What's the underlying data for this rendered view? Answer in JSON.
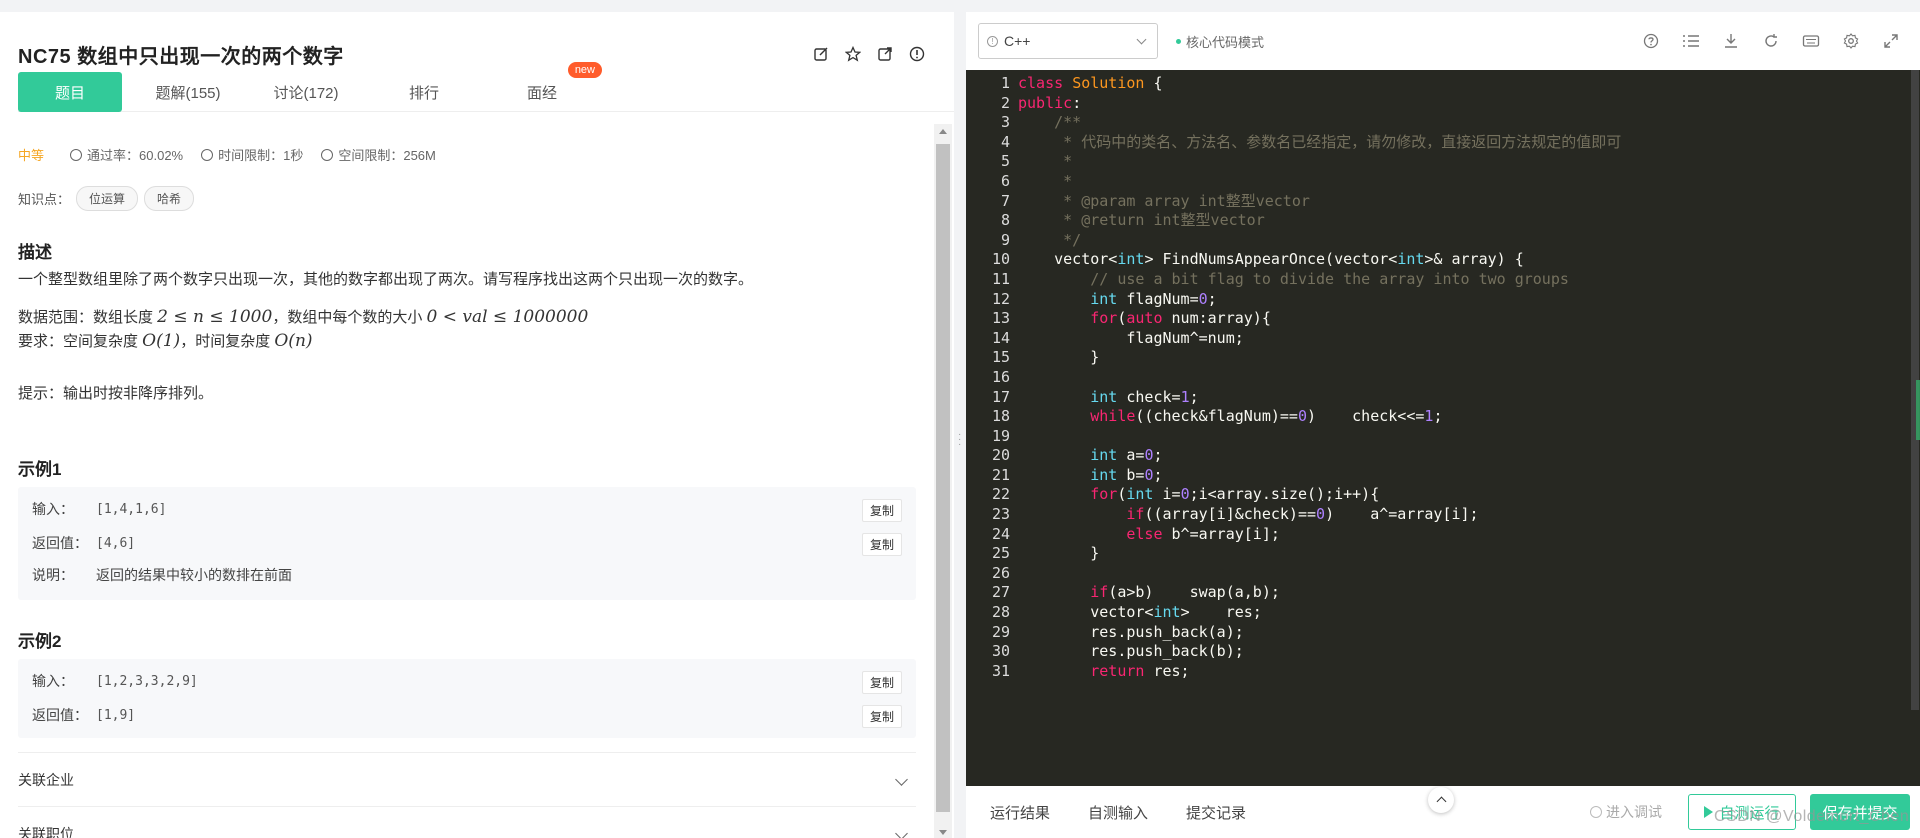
{
  "problem": {
    "title": "NC75  数组中只出现一次的两个数字",
    "header_icons": [
      "edit-icon",
      "star-icon",
      "share-icon",
      "info-icon"
    ]
  },
  "tabs": [
    {
      "label": "题目",
      "active": true
    },
    {
      "label": "题解(155)"
    },
    {
      "label": "讨论(172)"
    },
    {
      "label": "排行"
    },
    {
      "label": "面经",
      "badge": "new"
    }
  ],
  "meta": {
    "level": "中等",
    "pass_rate": "通过率：60.02%",
    "time_limit": "时间限制：1秒",
    "space_limit": "空间限制：256M"
  },
  "knowledge": {
    "label": "知识点：",
    "tags": [
      "位运算",
      "哈希"
    ]
  },
  "description": {
    "title": "描述",
    "text": "一个整型数组里除了两个数字只出现一次，其他的数字都出现了两次。请写程序找出这两个只出现一次的数字。",
    "range_prefix": "数据范围：数组长度 ",
    "range_math1": "2 ≤ n ≤ 1000",
    "range_mid": "，数组中每个数的大小 ",
    "range_math2": "0 < val ≤ 1000000",
    "req_prefix": "要求：空间复杂度 ",
    "req_math1": "O(1)",
    "req_mid": "，时间复杂度 ",
    "req_math2": "O(n)",
    "hint": "提示：输出时按非降序排列。"
  },
  "example1": {
    "title": "示例1",
    "input_label": "输入：",
    "input_value": "[1,4,1,6]",
    "output_label": "返回值：",
    "output_value": "[4,6]",
    "explain_label": "说明：",
    "explain_value": "返回的结果中较小的数排在前面",
    "copy_label": "复制"
  },
  "example2": {
    "title": "示例2",
    "input_label": "输入：",
    "input_value": "[1,2,3,3,2,9]",
    "output_label": "返回值：",
    "output_value": "[1,9]",
    "copy_label": "复制"
  },
  "collapsibles": [
    "关联企业",
    "关联职位"
  ],
  "editor": {
    "language": "C++",
    "mode": "核心代码模式",
    "toolbar_icons": [
      "help-icon",
      "list-icon",
      "download-icon",
      "refresh-icon",
      "keyboard-icon",
      "settings-icon",
      "fullscreen-icon"
    ]
  },
  "code_lines": [
    "class Solution {",
    "public:",
    "    /**",
    "     * 代码中的类名、方法名、参数名已经指定，请勿修改，直接返回方法规定的值即可",
    "     *",
    "     *",
    "     * @param array int整型vector",
    "     * @return int整型vector",
    "     */",
    "    vector<int> FindNumsAppearOnce(vector<int>& array) {",
    "        // use a bit flag to divide the array into two groups",
    "        int flagNum=0;",
    "        for(auto num:array){",
    "            flagNum^=num;",
    "        }",
    "",
    "        int check=1;",
    "        while((check&flagNum)==0)    check<<=1;",
    "",
    "        int a=0;",
    "        int b=0;",
    "        for(int i=0;i<array.size();i++){",
    "            if((array[i]&check)==0)    a^=array[i];",
    "            else b^=array[i];",
    "        }",
    "",
    "        if(a>b)    swap(a,b);",
    "        vector<int>    res;",
    "        res.push_back(a);",
    "        res.push_back(b);",
    "        return res;"
  ],
  "bottom": {
    "tabs": [
      "运行结果",
      "自测输入",
      "提交记录"
    ],
    "debug": "进入调试",
    "run": "自测运行",
    "submit": "保存并提交"
  },
  "watermark": "CSDN @Voldemort_Chen"
}
